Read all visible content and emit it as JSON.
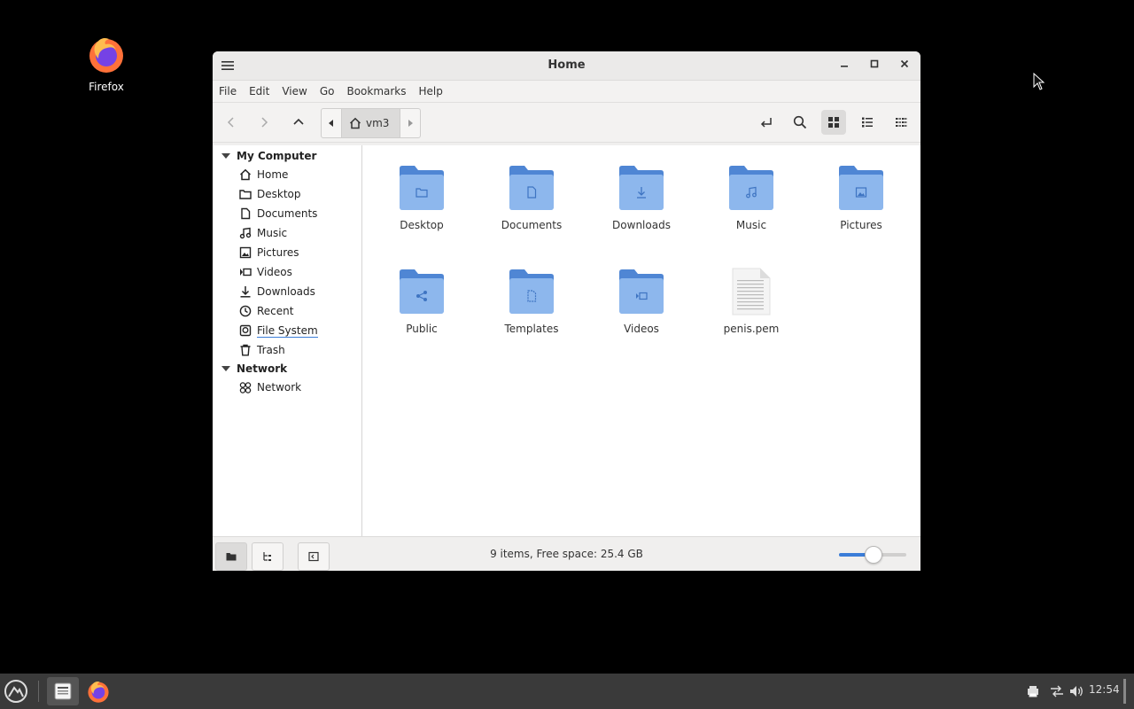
{
  "desktop": {
    "firefox_label": "Firefox"
  },
  "window": {
    "title": "Home"
  },
  "menubar": [
    "File",
    "Edit",
    "View",
    "Go",
    "Bookmarks",
    "Help"
  ],
  "pathbar": {
    "current": "vm3"
  },
  "sidebar": {
    "sections": [
      {
        "title": "My Computer",
        "items": [
          {
            "label": "Home",
            "icon": "home-icon"
          },
          {
            "label": "Desktop",
            "icon": "folder-icon"
          },
          {
            "label": "Documents",
            "icon": "document-icon"
          },
          {
            "label": "Music",
            "icon": "music-icon"
          },
          {
            "label": "Pictures",
            "icon": "picture-icon"
          },
          {
            "label": "Videos",
            "icon": "video-icon"
          },
          {
            "label": "Downloads",
            "icon": "download-icon"
          },
          {
            "label": "Recent",
            "icon": "clock-icon"
          },
          {
            "label": "File System",
            "icon": "drive-icon",
            "selected": true
          },
          {
            "label": "Trash",
            "icon": "trash-icon"
          }
        ]
      },
      {
        "title": "Network",
        "items": [
          {
            "label": "Network",
            "icon": "network-icon"
          }
        ]
      }
    ]
  },
  "files": [
    {
      "label": "Desktop",
      "type": "folder",
      "emblem": "folder"
    },
    {
      "label": "Documents",
      "type": "folder",
      "emblem": "document"
    },
    {
      "label": "Downloads",
      "type": "folder",
      "emblem": "download"
    },
    {
      "label": "Music",
      "type": "folder",
      "emblem": "music"
    },
    {
      "label": "Pictures",
      "type": "folder",
      "emblem": "picture"
    },
    {
      "label": "Public",
      "type": "folder",
      "emblem": "share"
    },
    {
      "label": "Templates",
      "type": "folder",
      "emblem": "template"
    },
    {
      "label": "Videos",
      "type": "folder",
      "emblem": "video"
    },
    {
      "label": "penis.pem",
      "type": "file"
    }
  ],
  "statusbar": {
    "text": "9 items, Free space: 25.4 GB",
    "zoom_fraction": 0.5
  },
  "taskbar": {
    "clock": "12:54"
  },
  "colors": {
    "folder": "#6ea2e6",
    "folder_tab": "#4f86d4",
    "accent": "#3b7dd8"
  }
}
